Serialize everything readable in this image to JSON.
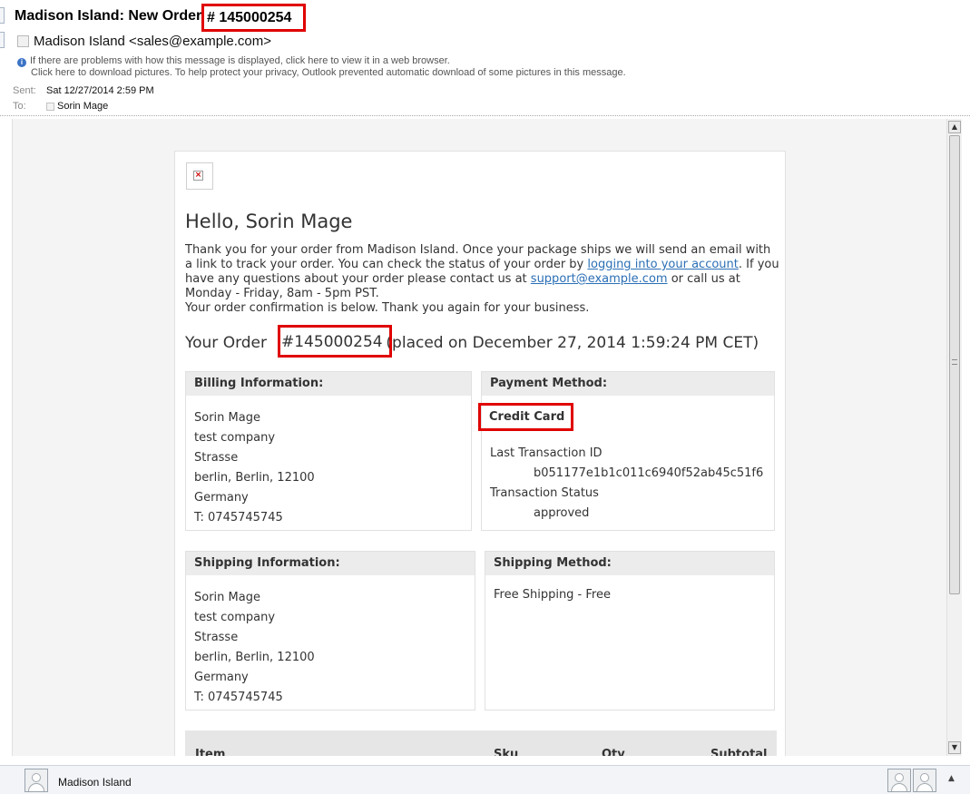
{
  "header": {
    "subject_prefix": "Madison Island: New Order",
    "subject_order": "# 145000254",
    "from": "Madison Island <sales@example.com>",
    "info_line1": "If there are problems with how this message is displayed, click here to view it in a web browser.",
    "info_line2": "Click here to download pictures. To help protect your privacy, Outlook prevented automatic download of some pictures in this message.",
    "sent_label": "Sent:",
    "sent_value": "Sat 12/27/2014 2:59 PM",
    "to_label": "To:",
    "to_value": "Sorin Mage"
  },
  "email": {
    "greeting": "Hello, Sorin Mage",
    "para1_before_link": "Thank you for your order from Madison Island. Once your package ships we will send an email with a link to track your order. You can check the status of your order by ",
    "account_link": "logging into your account",
    "para1_mid": ". If you have any questions about your order please contact us at ",
    "support_link": "support@example.com",
    "para1_after": " or call us at Monday - Friday, 8am - 5pm PST.",
    "para2": "Your order confirmation is below. Thank you again for your business.",
    "your_order_label": "Your Order",
    "order_number": "#145000254",
    "placed_on": "(placed on December 27, 2014 1:59:24 PM CET)",
    "billing": {
      "title": "Billing Information:",
      "lines": [
        "Sorin Mage",
        "test company",
        "Strasse",
        "berlin, Berlin, 12100",
        "Germany",
        "T: 0745745745"
      ]
    },
    "payment": {
      "title": "Payment Method:",
      "method": "Credit Card",
      "txn_id_label": "Last Transaction ID",
      "txn_id": "b051177e1b1c011c6940f52ab45c51f6",
      "txn_status_label": "Transaction Status",
      "txn_status": "approved"
    },
    "shipping": {
      "title": "Shipping Information:",
      "lines": [
        "Sorin Mage",
        "test company",
        "Strasse",
        "berlin, Berlin, 12100",
        "Germany",
        "T: 0745745745"
      ]
    },
    "shipping_method": {
      "title": "Shipping Method:",
      "value": "Free Shipping - Free"
    },
    "items_table": {
      "headers": [
        "Item",
        "Sku",
        "Qty",
        "Subtotal"
      ]
    }
  },
  "scrollbar": {
    "up_icon": "▲",
    "down_icon": "▼"
  },
  "footer": {
    "contact_name": "Madison Island",
    "collapse_icon": "▲"
  },
  "colors": {
    "highlight_red": "#e00000",
    "link_blue": "#2b6fb5",
    "panel_header_gray": "#ececec"
  }
}
